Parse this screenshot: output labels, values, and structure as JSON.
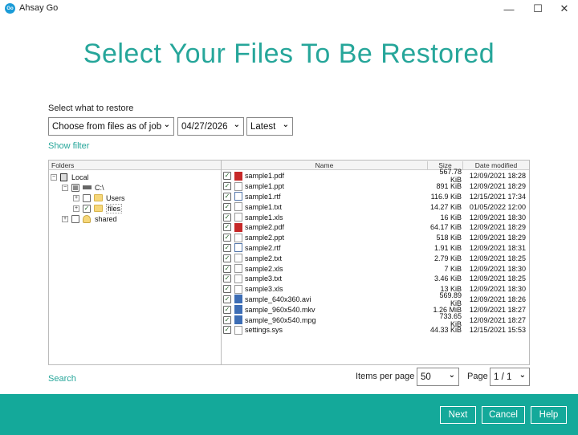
{
  "window": {
    "logo_text": "Go",
    "title": "Ahsay Go",
    "minimize_glyph": "—",
    "maximize_glyph": "☐",
    "close_glyph": "✕"
  },
  "page": {
    "title": "Select Your Files To Be Restored"
  },
  "restore_options": {
    "label": "Select what to restore",
    "mode": "Choose from files as of job",
    "date": "04/27/2026",
    "version": "Latest",
    "show_filter": "Show filter"
  },
  "folders": {
    "header": "Folders",
    "tree": [
      {
        "label": "Local",
        "expander": "−",
        "check": "none",
        "icon": "computer-icon"
      },
      {
        "label": "C:\\",
        "expander": "−",
        "check": "partial",
        "icon": "drive-icon"
      },
      {
        "label": "Users",
        "expander": "+",
        "check": "unchecked",
        "icon": "folder-icon"
      },
      {
        "label": "files",
        "expander": "+",
        "check": "checked",
        "icon": "folder-icon"
      },
      {
        "label": "shared",
        "expander": "+",
        "check": "unchecked",
        "icon": "shared-folder-icon"
      }
    ]
  },
  "files": {
    "columns": {
      "name": "Name",
      "size": "Size",
      "date": "Date modified"
    },
    "rows": [
      {
        "name": "sample1.pdf",
        "size": "567.78 KiB",
        "date": "12/09/2021 18:28",
        "type": "pdf"
      },
      {
        "name": "sample1.ppt",
        "size": "891 KiB",
        "date": "12/09/2021 18:29",
        "type": "doc"
      },
      {
        "name": "sample1.rtf",
        "size": "116.9 KiB",
        "date": "12/15/2021 17:34",
        "type": "rtf"
      },
      {
        "name": "sample1.txt",
        "size": "14.27 KiB",
        "date": "01/05/2022 12:00",
        "type": "doc"
      },
      {
        "name": "sample1.xls",
        "size": "16 KiB",
        "date": "12/09/2021 18:30",
        "type": "doc"
      },
      {
        "name": "sample2.pdf",
        "size": "64.17 KiB",
        "date": "12/09/2021 18:29",
        "type": "pdf"
      },
      {
        "name": "sample2.ppt",
        "size": "518 KiB",
        "date": "12/09/2021 18:29",
        "type": "doc"
      },
      {
        "name": "sample2.rtf",
        "size": "1.91 KiB",
        "date": "12/09/2021 18:31",
        "type": "rtf"
      },
      {
        "name": "sample2.txt",
        "size": "2.79 KiB",
        "date": "12/09/2021 18:25",
        "type": "doc"
      },
      {
        "name": "sample2.xls",
        "size": "7 KiB",
        "date": "12/09/2021 18:30",
        "type": "doc"
      },
      {
        "name": "sample3.txt",
        "size": "3.46 KiB",
        "date": "12/09/2021 18:25",
        "type": "doc"
      },
      {
        "name": "sample3.xls",
        "size": "13 KiB",
        "date": "12/09/2021 18:30",
        "type": "doc"
      },
      {
        "name": "sample_640x360.avi",
        "size": "569.89 KiB",
        "date": "12/09/2021 18:26",
        "type": "video"
      },
      {
        "name": "sample_960x540.mkv",
        "size": "1.26 MiB",
        "date": "12/09/2021 18:27",
        "type": "video"
      },
      {
        "name": "sample_960x540.mpg",
        "size": "733.65 KiB",
        "date": "12/09/2021 18:27",
        "type": "video"
      },
      {
        "name": "settings.sys",
        "size": "44.33 KiB",
        "date": "12/15/2021 15:53",
        "type": "doc"
      }
    ]
  },
  "bottom_bar": {
    "search": "Search",
    "items_per_page_label": "Items per page",
    "items_per_page": "50",
    "page_label": "Page",
    "page": "1 / 1"
  },
  "footer": {
    "next": "Next",
    "cancel": "Cancel",
    "help": "Help"
  },
  "colors": {
    "accent": "#26a69a",
    "footer_bg": "#14a99a"
  }
}
